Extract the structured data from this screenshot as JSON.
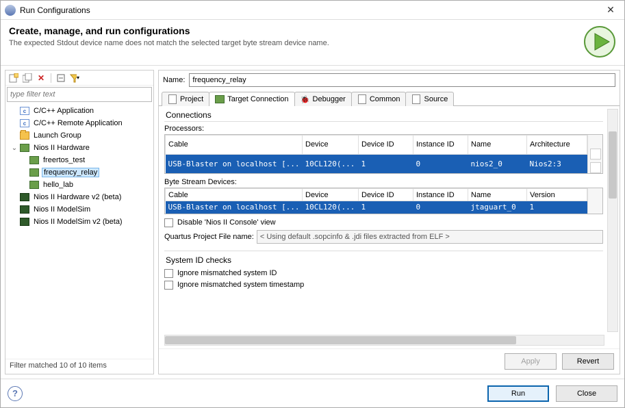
{
  "window": {
    "title": "Run Configurations"
  },
  "header": {
    "title": "Create, manage, and run configurations",
    "subtitle": "The expected Stdout device name does not match the selected target byte stream device name."
  },
  "left": {
    "filter_placeholder": "type filter text",
    "status": "Filter matched 10 of 10 items",
    "tree": {
      "cc_app": "C/C++ Application",
      "cc_remote": "C/C++ Remote Application",
      "launch_group": "Launch Group",
      "nios_hw": "Nios II Hardware",
      "freertos": "freertos_test",
      "frequency": "frequency_relay",
      "hello": "hello_lab",
      "nios_hw_v2": "Nios II Hardware v2 (beta)",
      "nios_modelsim": "Nios II ModelSim",
      "nios_modelsim_v2": "Nios II ModelSim v2 (beta)"
    }
  },
  "right": {
    "name_label": "Name:",
    "name_value": "frequency_relay",
    "tabs": {
      "project": "Project",
      "target": "Target Connection",
      "debugger": "Debugger",
      "common": "Common",
      "source": "Source"
    },
    "connections_title": "Connections",
    "processors_label": "Processors:",
    "byte_devices_label": "Byte Stream Devices:",
    "columns": {
      "cable": "Cable",
      "device": "Device",
      "device_id": "Device ID",
      "instance_id": "Instance ID",
      "name": "Name",
      "architecture": "Architecture",
      "version": "Version"
    },
    "processor_row": {
      "cable": "USB-Blaster on localhost [...",
      "device": "10CL120(...",
      "device_id": "1",
      "instance_id": "0",
      "name": "nios2_0",
      "architecture": "Nios2:3"
    },
    "byte_row": {
      "cable": "USB-Blaster on localhost [...",
      "device": "10CL120(...",
      "device_id": "1",
      "instance_id": "0",
      "name": "jtaguart_0",
      "version": "1"
    },
    "disable_console": "Disable 'Nios II Console' view",
    "qpf_label": "Quartus Project File name:",
    "qpf_value": "< Using default .sopcinfo & .jdi files extracted from ELF >",
    "sysid_title": "System ID checks",
    "ignore_sysid": "Ignore mismatched system ID",
    "ignore_ts": "Ignore mismatched system timestamp",
    "apply": "Apply",
    "revert": "Revert"
  },
  "footer": {
    "run": "Run",
    "close": "Close"
  }
}
